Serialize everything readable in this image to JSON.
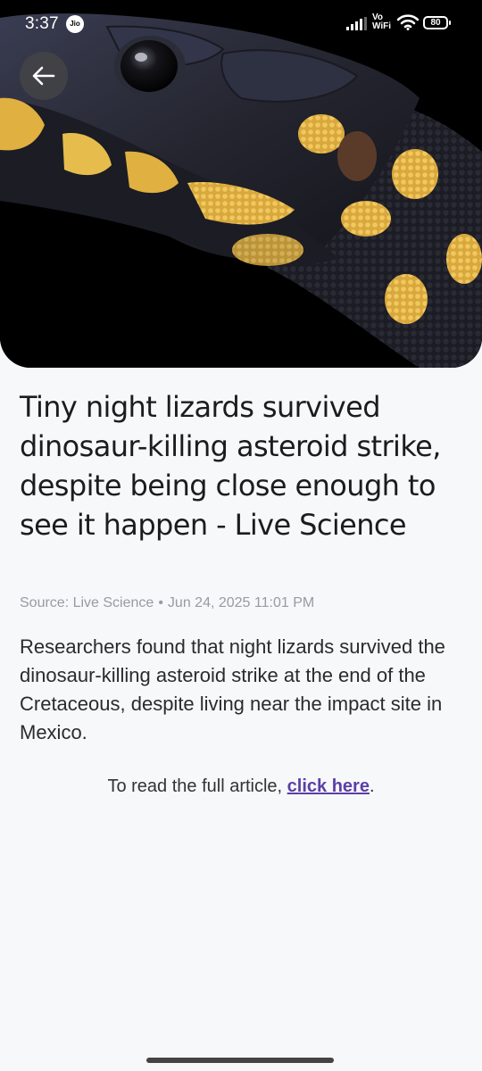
{
  "status_bar": {
    "time": "3:37",
    "carrier_badge": "Jio",
    "vowifi_line1": "Vo",
    "vowifi_line2": "WiFi",
    "battery": "80",
    "icons": [
      "signal-icon",
      "wifi-icon",
      "battery-icon"
    ]
  },
  "hero": {
    "icon": "lizard-photo",
    "colors": {
      "scale_dark": "#1b1c24",
      "scale_yellow": "#e0b040",
      "background": "#000000"
    }
  },
  "nav": {
    "back_icon": "arrow-left-icon"
  },
  "article": {
    "title": "Tiny night lizards survived dinosaur-killing asteroid strike, despite being close enough to see it happen - Live Science",
    "source": "Source: Live Science",
    "separator": "•",
    "date": "Jun 24, 2025 11:01 PM",
    "summary": "Researchers found that night lizards survived the dinosaur-killing asteroid strike at the end of the Cretaceous, despite living near the impact site in Mexico.",
    "read_more_prefix": "To read the full article, ",
    "read_more_link": "click here",
    "read_more_suffix": ".",
    "link_color": "#5b3fa6"
  }
}
